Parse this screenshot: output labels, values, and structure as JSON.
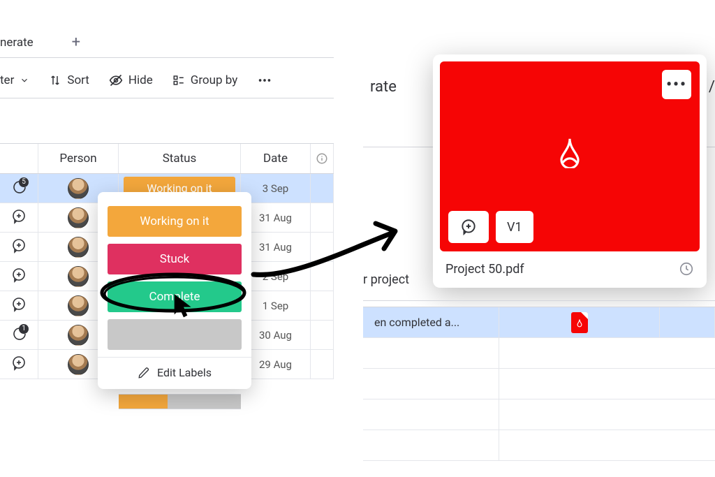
{
  "left": {
    "top_label": "nerate",
    "toolbar": {
      "filter": "ter",
      "sort": "Sort",
      "hide": "Hide",
      "group": "Group by"
    },
    "columns": {
      "person": "Person",
      "status": "Status",
      "date": "Date"
    },
    "rows": [
      {
        "badge": "5",
        "status": "Working on it",
        "date": "3 Sep",
        "selected": true
      },
      {
        "badge": "",
        "date": "31 Aug"
      },
      {
        "badge": "",
        "date": "31 Aug"
      },
      {
        "badge": "",
        "date": "2 Sep"
      },
      {
        "badge": "",
        "date": "1 Sep"
      },
      {
        "badge": "1",
        "date": "30 Aug"
      },
      {
        "badge": "",
        "date": "29 Aug"
      }
    ],
    "dropdown": {
      "working": "Working on it",
      "stuck": "Stuck",
      "complete": "Complete",
      "edit": "Edit Labels"
    }
  },
  "right": {
    "rate_fragment": "rate",
    "slash_fragment": "e /",
    "file": {
      "name": "Project 50.pdf",
      "version": "V1",
      "more": "•••"
    },
    "project_fragment": "r project",
    "row_text": "en completed a..."
  }
}
